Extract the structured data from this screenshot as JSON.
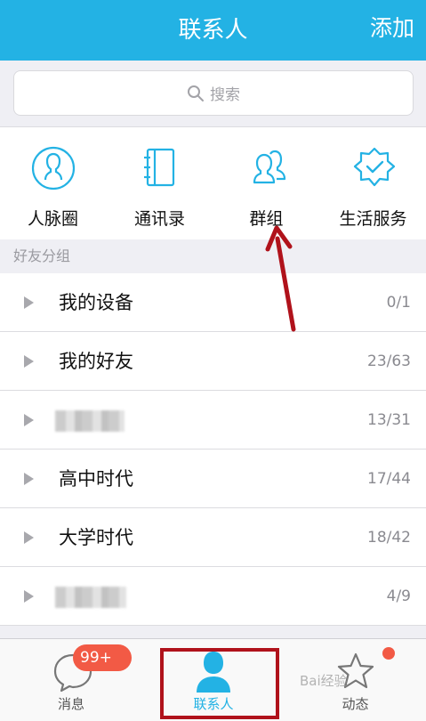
{
  "header": {
    "title": "联系人",
    "add_label": "添加"
  },
  "search": {
    "placeholder": "搜索",
    "icon": "search-icon"
  },
  "quick_actions": [
    {
      "label": "人脉圈",
      "icon": "person-circle-icon"
    },
    {
      "label": "通讯录",
      "icon": "address-book-icon"
    },
    {
      "label": "群组",
      "icon": "group-icon"
    },
    {
      "label": "生活服务",
      "icon": "badge-check-icon"
    }
  ],
  "section_title": "好友分组",
  "groups": [
    {
      "name": "我的设备",
      "count": "0/1"
    },
    {
      "name": "我的好友",
      "count": "23/63"
    },
    {
      "name": "",
      "count": "13/31",
      "blurred": true
    },
    {
      "name": "高中时代",
      "count": "17/44"
    },
    {
      "name": "大学时代",
      "count": "18/42"
    },
    {
      "name": "",
      "count": "4/9",
      "blurred": true
    }
  ],
  "tabbar": {
    "messages": {
      "label": "消息",
      "badge": "99+"
    },
    "contacts": {
      "label": "联系人"
    },
    "feeds": {
      "label": "动态"
    }
  },
  "watermark": "Bai经验",
  "colors": {
    "brand": "#23b2e4",
    "badge": "#f25a45",
    "annotation": "#b0121b"
  }
}
